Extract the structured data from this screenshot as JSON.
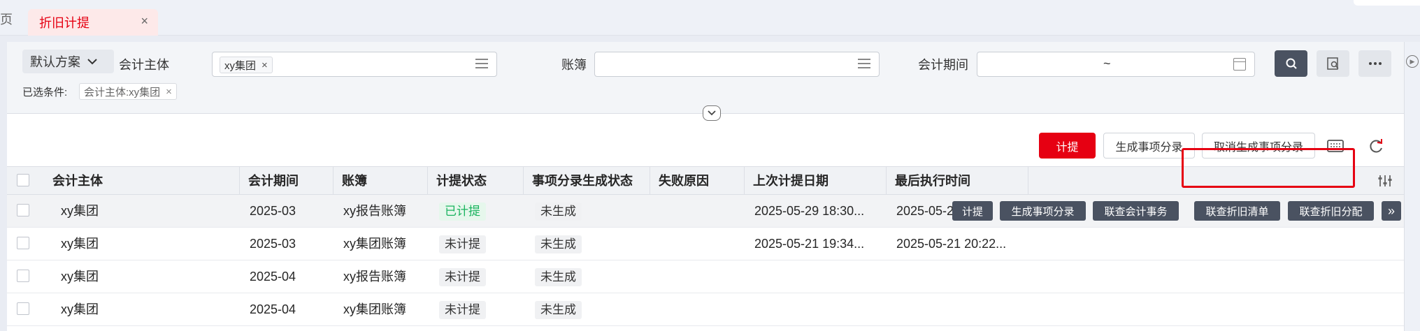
{
  "tabs": {
    "prev_label": "页",
    "active_label": "折旧计提",
    "close_glyph": "×"
  },
  "filter": {
    "scheme_label": "默认方案",
    "entity_label": "会计主体",
    "entity_tag": "xy集团",
    "book_label": "账簿",
    "book_value": "",
    "period_label": "会计期间",
    "period_separator": "~",
    "chosen_label": "已选条件:",
    "chosen_tag": "会计主体:xy集团",
    "buttons": [
      "search-icon",
      "advanced-search-icon",
      "more-icon"
    ]
  },
  "actions": {
    "accrue": "计提",
    "generate": "生成事项分录",
    "cancel_generate": "取消生成事项分录"
  },
  "table": {
    "columns": [
      "会计主体",
      "会计期间",
      "账簿",
      "计提状态",
      "事项分录生成状态",
      "失败原因",
      "上次计提日期",
      "最后执行时间"
    ],
    "rows": [
      {
        "entity": "xy集团",
        "period": "2025-03",
        "book": "xy报告账簿",
        "status": "已计提",
        "gen_status": "未生成",
        "reason": "",
        "last_date": "2025-05-29 18:30...",
        "last_exec": "2025-05-2"
      },
      {
        "entity": "xy集团",
        "period": "2025-03",
        "book": "xy集团账簿",
        "status": "未计提",
        "gen_status": "未生成",
        "reason": "",
        "last_date": "2025-05-21 19:34...",
        "last_exec": "2025-05-21 20:22..."
      },
      {
        "entity": "xy集团",
        "period": "2025-04",
        "book": "xy报告账簿",
        "status": "未计提",
        "gen_status": "未生成",
        "reason": "",
        "last_date": "",
        "last_exec": ""
      },
      {
        "entity": "xy集团",
        "period": "2025-04",
        "book": "xy集团账簿",
        "status": "未计提",
        "gen_status": "未生成",
        "reason": "",
        "last_date": "",
        "last_exec": ""
      }
    ],
    "row_ops": [
      "计提",
      "生成事项分录",
      "联查会计事务",
      "联查折旧清单",
      "联查折旧分配"
    ],
    "more_ops": "»"
  },
  "colors": {
    "primary": "#e60012",
    "op_button": "#4a5261",
    "status_done": "#19b35e"
  }
}
